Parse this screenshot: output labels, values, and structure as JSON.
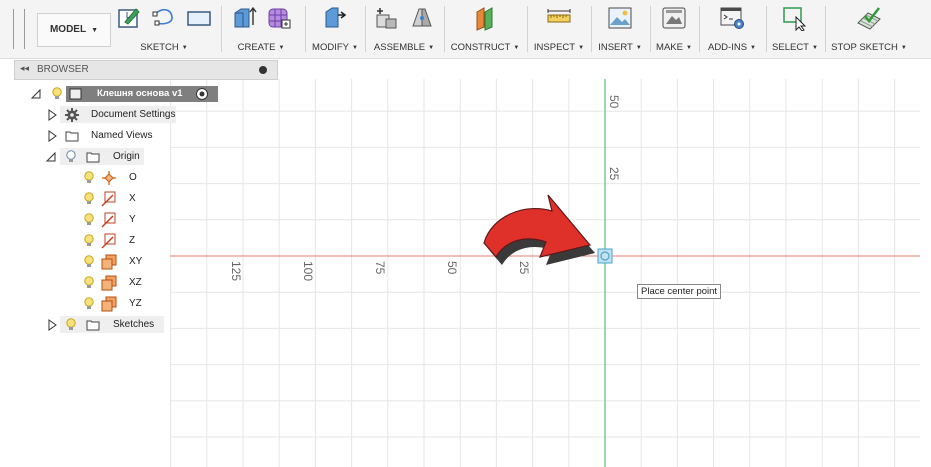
{
  "toolbar": {
    "mode_label": "MODEL",
    "groups": [
      {
        "label": "SKETCH"
      },
      {
        "label": "CREATE"
      },
      {
        "label": "MODIFY"
      },
      {
        "label": "ASSEMBLE"
      },
      {
        "label": "CONSTRUCT"
      },
      {
        "label": "INSPECT"
      },
      {
        "label": "INSERT"
      },
      {
        "label": "MAKE"
      },
      {
        "label": "ADD-INS"
      },
      {
        "label": "SELECT"
      },
      {
        "label": "STOP SKETCH"
      }
    ]
  },
  "browser": {
    "title": "BROWSER",
    "items": [
      {
        "label": "Клешня основа v1"
      },
      {
        "label": "Document Settings"
      },
      {
        "label": "Named Views"
      },
      {
        "label": "Origin"
      },
      {
        "label": "O"
      },
      {
        "label": "X"
      },
      {
        "label": "Y"
      },
      {
        "label": "Z"
      },
      {
        "label": "XY"
      },
      {
        "label": "XZ"
      },
      {
        "label": "YZ"
      },
      {
        "label": "Sketches"
      }
    ]
  },
  "canvas": {
    "x_ticks": [
      "125",
      "100",
      "75",
      "50",
      "25"
    ],
    "y_ticks": [
      "50",
      "25"
    ],
    "tooltip": "Place center point"
  },
  "colors": {
    "x_axis": "#e08070",
    "y_axis": "#56c46a",
    "arrow": "#e0302a",
    "grid": "#e4e4e4"
  }
}
